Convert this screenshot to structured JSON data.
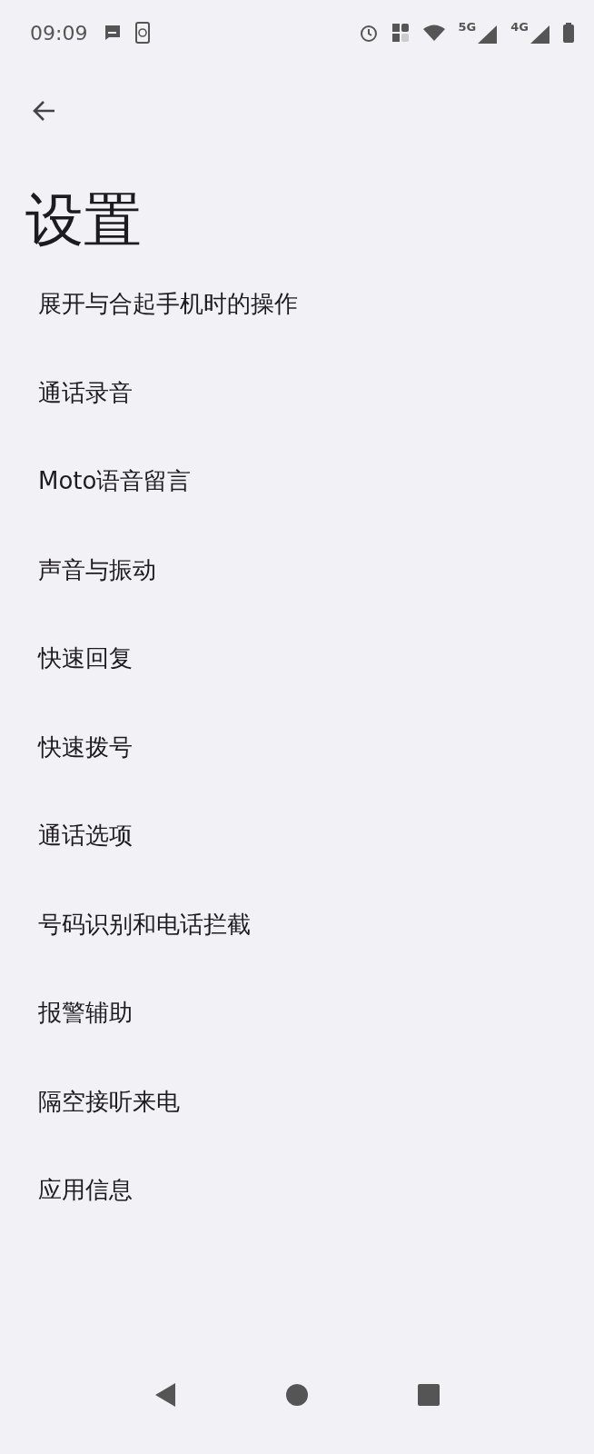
{
  "status_bar": {
    "time": "09:09",
    "network_labels": [
      "5G",
      "4G"
    ]
  },
  "title": "设置",
  "items": [
    {
      "label": "展开与合起手机时的操作"
    },
    {
      "label": "通话录音"
    },
    {
      "label": "Moto语音留言"
    },
    {
      "label": "声音与振动"
    },
    {
      "label": "快速回复"
    },
    {
      "label": "快速拨号"
    },
    {
      "label": "通话选项"
    },
    {
      "label": "号码识别和电话拦截"
    },
    {
      "label": "报警辅助"
    },
    {
      "label": "隔空接听来电"
    },
    {
      "label": "应用信息"
    }
  ]
}
